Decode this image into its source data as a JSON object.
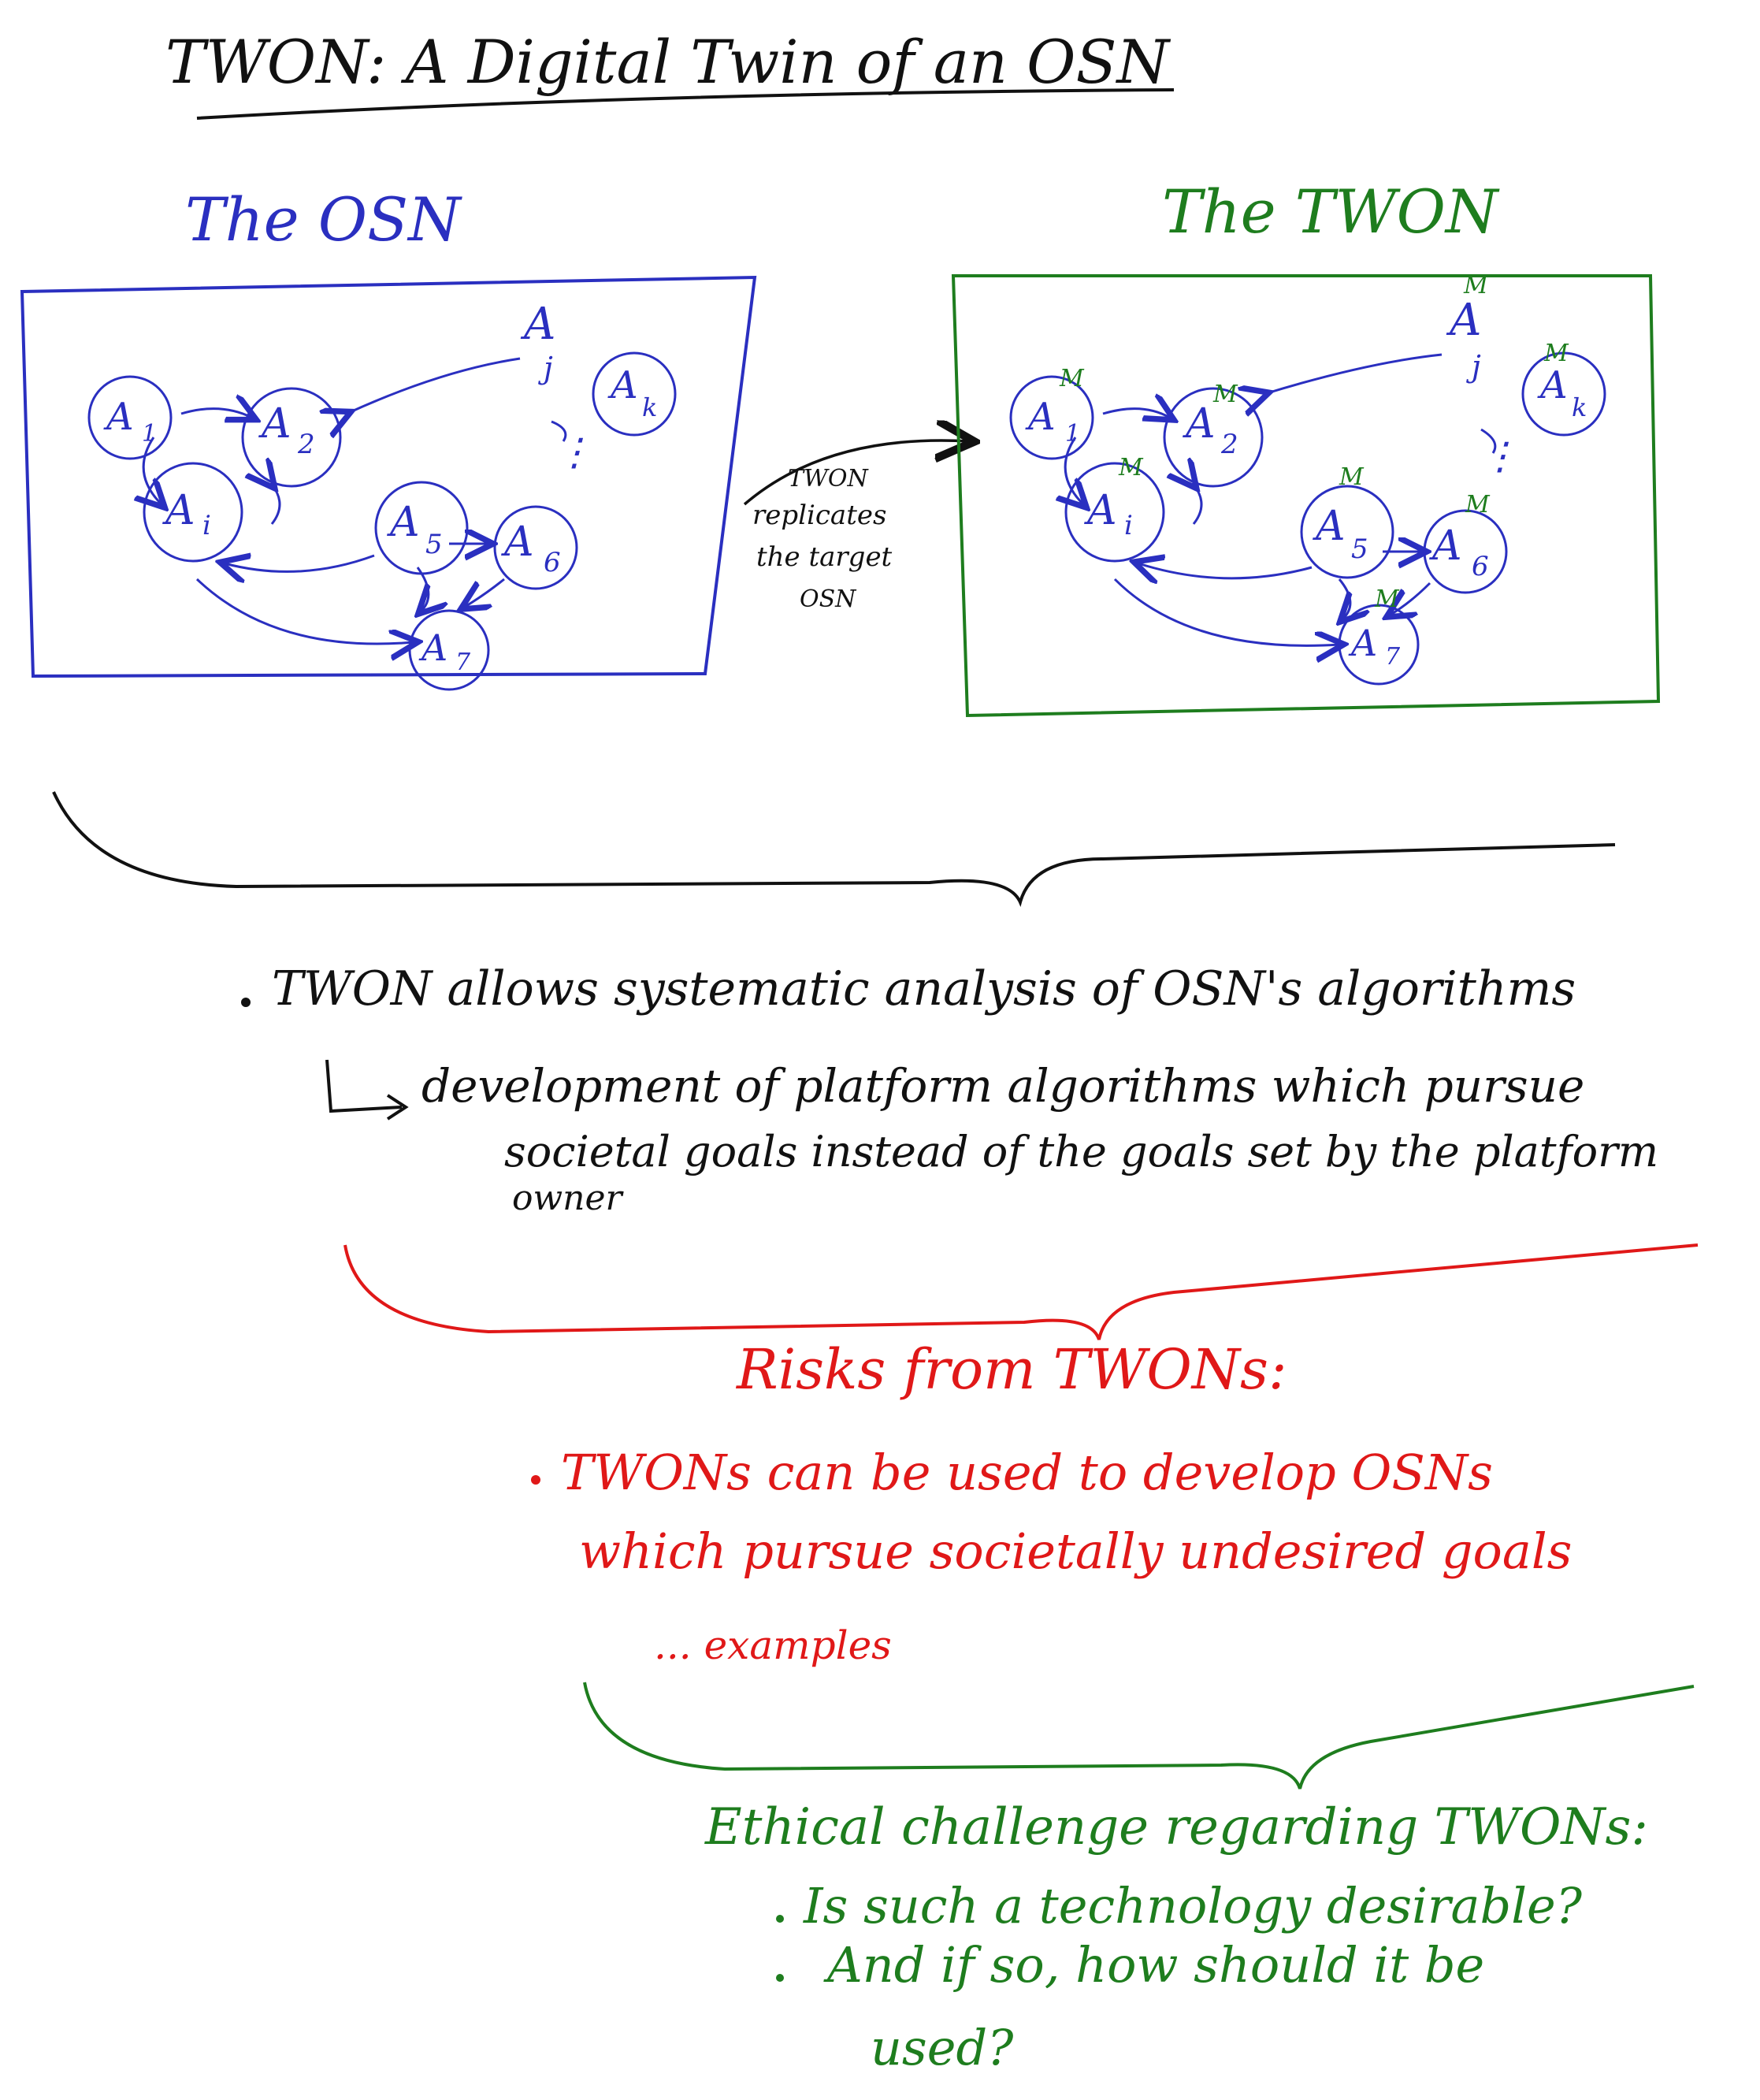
{
  "title": "TWON: A Digital Twin of an OSN",
  "colors": {
    "ink": "#111111",
    "osn_blue": "#2a2fc0",
    "twon_green": "#1e7d1e",
    "risk_red": "#e01818"
  },
  "osn_panel": {
    "heading": "The OSN",
    "nodes": {
      "a1": "A",
      "a1_sub": "1",
      "a2": "A",
      "a2_sub": "2",
      "ai": "A",
      "ai_sub": "i",
      "a5": "A",
      "a5_sub": "5",
      "a6": "A",
      "a6_sub": "6",
      "a7": "A",
      "a7_sub": "7",
      "ak": "A",
      "ak_sub": "k",
      "aj": "A",
      "aj_sub": "j"
    },
    "ellipsis": "⋮"
  },
  "twon_panel": {
    "heading": "The TWON",
    "model_mark": "M",
    "nodes": {
      "a1": "A",
      "a1_sub": "1",
      "a2": "A",
      "a2_sub": "2",
      "ai": "A",
      "ai_sub": "i",
      "a5": "A",
      "a5_sub": "5",
      "a6": "A",
      "a6_sub": "6",
      "a7": "A",
      "a7_sub": "7",
      "ak": "A",
      "ak_sub": "k",
      "aj": "A",
      "aj_sub": "j"
    },
    "ellipsis": "⋮"
  },
  "replicate_arrow": {
    "line1": "TWON",
    "line2": "replicates",
    "line3": "the target",
    "line4": "OSN"
  },
  "analysis": {
    "bullet": "TWON allows systematic analysis of OSN's algorithms",
    "arrow_line1": "development of platform algorithms which pursue",
    "arrow_line2": "societal goals instead of the goals set by the platform",
    "arrow_line3": "owner"
  },
  "risks": {
    "heading": "Risks from TWONs:",
    "bullet_line1": "TWONs can be used to develop OSNs",
    "bullet_line2": "which pursue societally undesired goals",
    "examples": "... examples"
  },
  "ethics": {
    "heading": "Ethical challenge regarding TWONs:",
    "q1": "Is such a technology desirable?",
    "q2_line1": "And if so, how should it be",
    "q2_line2": "used?"
  }
}
